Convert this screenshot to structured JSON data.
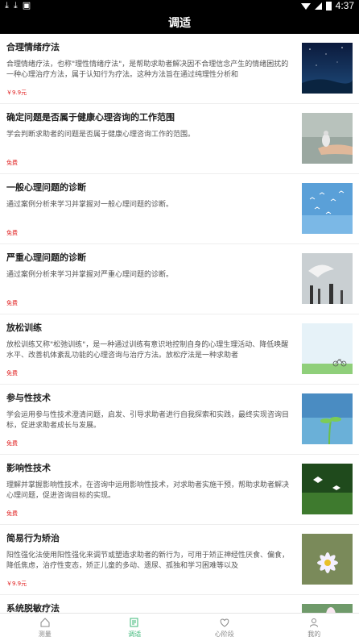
{
  "status": {
    "time": "4:37",
    "left_icons": [
      "download-icon",
      "download-icon",
      "notification-icon"
    ]
  },
  "header": {
    "title": "调适"
  },
  "items": [
    {
      "title": "合理情绪疗法",
      "desc": "合理情绪疗法，也称\"理性情绪疗法\"，是帮助求助者解决因不合理信念产生的情绪困扰的一种心理治疗方法，属于认知行为疗法。这种方法旨在通过纯理性分析和",
      "price": "￥9.9元",
      "thumb": "night-sky-image"
    },
    {
      "title": "确定问题是否属于健康心理咨询的工作范围",
      "desc": "学会判断求助者的问题是否属于健康心理咨询工作的范围。",
      "price": "免费",
      "thumb": "bird-on-hand-image"
    },
    {
      "title": "一般心理问题的诊断",
      "desc": "通过案例分析来学习并掌握对一般心理问题的诊断。",
      "price": "免费",
      "thumb": "birds-flying-image"
    },
    {
      "title": "严重心理问题的诊断",
      "desc": "通过案例分析来学习并掌握对严重心理问题的诊断。",
      "price": "免费",
      "thumb": "crane-image"
    },
    {
      "title": "放松训练",
      "desc": "放松训练又称\"松弛训练\"，是一种通过训练有意识地控制自身的心理生理活动、降低唤醒水平、改善机体紊乱功能的心理咨询与治疗方法。放松疗法是一种求助者",
      "price": "免费",
      "thumb": "bicycle-meadow-image"
    },
    {
      "title": "参与性技术",
      "desc": "学会运用参与性技术澄清问题，启发、引导求助者进行自我探索和实践，最终实现咨询目标，促进求助者成长与发展。",
      "price": "免费",
      "thumb": "sprout-image"
    },
    {
      "title": "影响性技术",
      "desc": "理解并掌握影响性技术，在咨询中运用影响性技术，对求助者实施干预，帮助求助者解决心理问题，促进咨询目标的实现。",
      "price": "免费",
      "thumb": "butterflies-image"
    },
    {
      "title": "简易行为矫治",
      "desc": "阳性强化法使用阳性强化来调节或塑造求助者的新行为，可用于矫正神经性厌食、偏食，降低焦虑，治疗性变态，矫正儿童的多动、遗尿、孤独和学习困难等以及",
      "price": "￥9.9元",
      "thumb": "flower-image"
    },
    {
      "title": "系统脱敏疗法",
      "desc": "",
      "price": "",
      "thumb": "flower-image"
    }
  ],
  "tabs": [
    {
      "label": "测量",
      "icon": "home-icon",
      "active": false
    },
    {
      "label": "调适",
      "icon": "edit-icon",
      "active": true
    },
    {
      "label": "心阶段",
      "icon": "heart-icon",
      "active": false
    },
    {
      "label": "我的",
      "icon": "user-icon",
      "active": false
    }
  ],
  "colors": {
    "accent": "#3fb87a",
    "price": "#e02020",
    "header_bg": "#000000"
  }
}
